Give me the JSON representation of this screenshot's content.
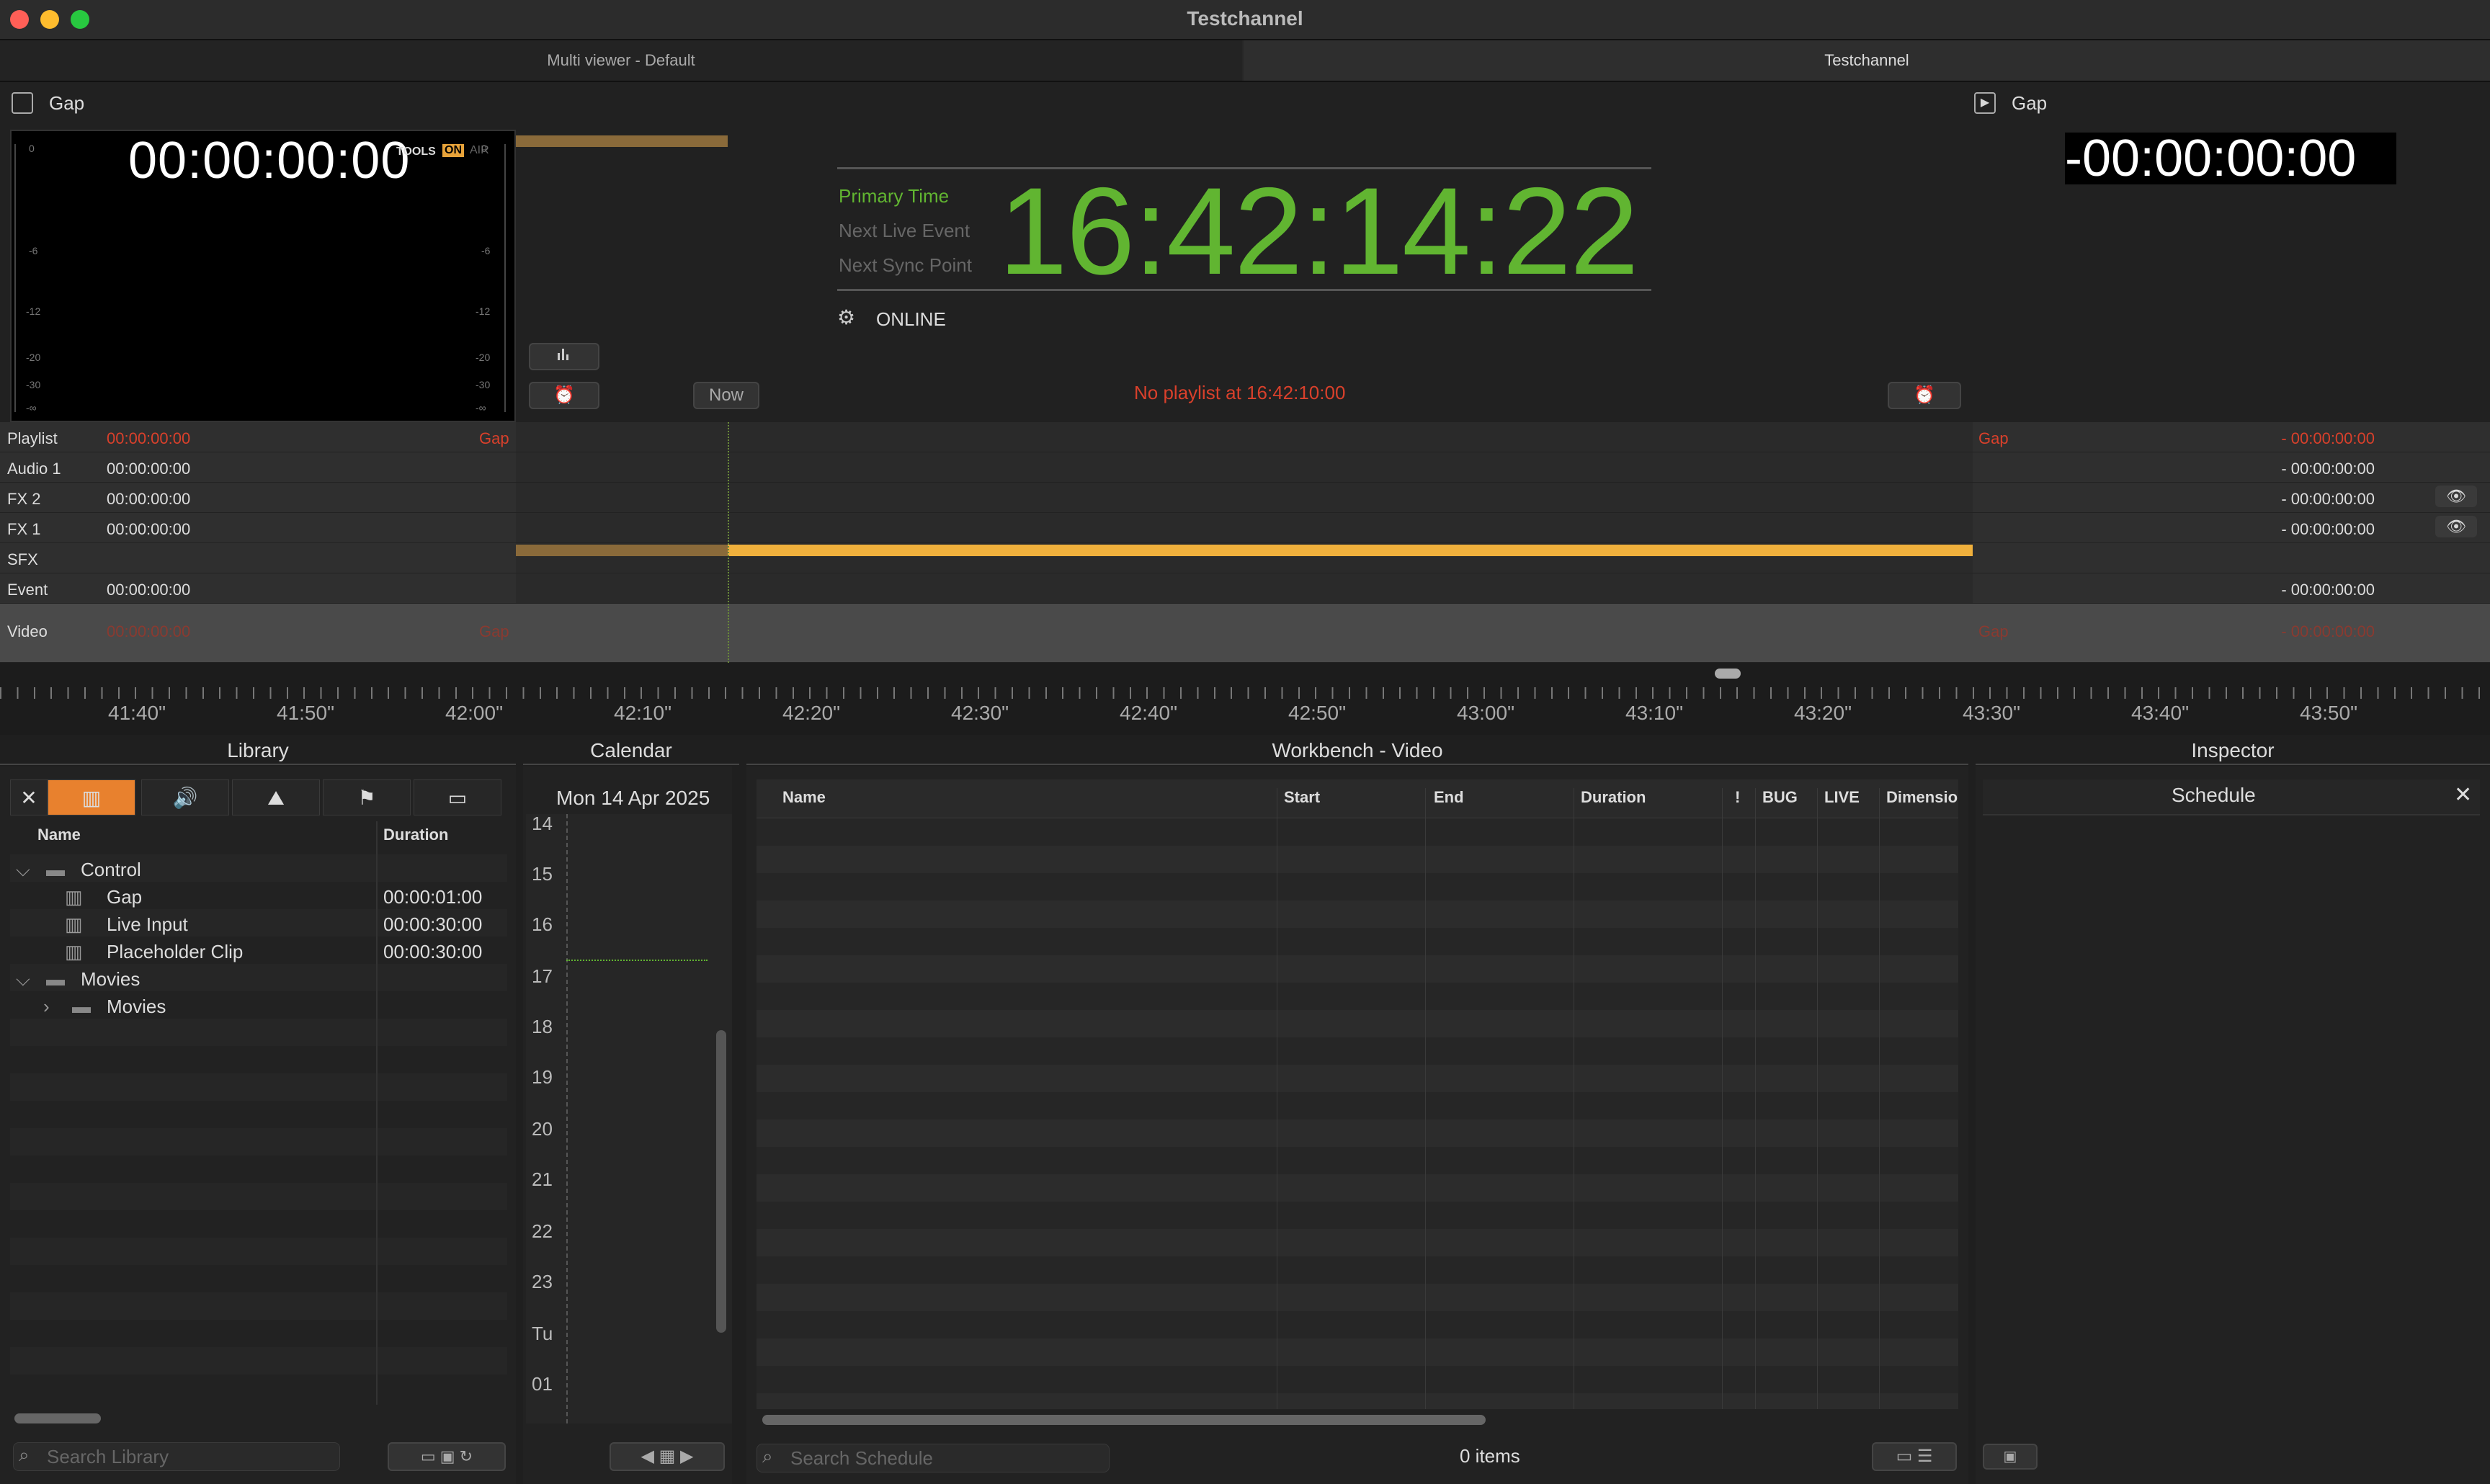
{
  "window": {
    "title": "Testchannel"
  },
  "tabs": [
    {
      "label": "Multi viewer - Default"
    },
    {
      "label": "Testchannel"
    }
  ],
  "preview_left": {
    "label": "Gap",
    "timecode": "00:00:00:00",
    "tools_label": "TOOLS",
    "on_label": "ON",
    "air_label": "AIR",
    "meter_scale": [
      "0",
      "-6",
      "-12",
      "-20",
      "-30",
      "-∞"
    ]
  },
  "preview_right": {
    "label": "Gap",
    "timecode": "-00:00:00:00"
  },
  "clock": {
    "labels": [
      "Primary Time",
      "Next Live Event",
      "Next Sync Point"
    ],
    "time": "16:42:14:22",
    "status": "ONLINE"
  },
  "controls": {
    "now_label": "Now",
    "playlist_message": "No playlist at 16:42:10:00"
  },
  "tracks": [
    {
      "name": "Playlist",
      "tc": "00:00:00:00",
      "gap": "Gap",
      "rgap": "Gap",
      "rtc": "- 00:00:00:00"
    },
    {
      "name": "Audio 1",
      "tc": "00:00:00:00",
      "gap": "",
      "rgap": "",
      "rtc": "- 00:00:00:00"
    },
    {
      "name": "FX 2",
      "tc": "00:00:00:00",
      "gap": "",
      "rgap": "",
      "rtc": "- 00:00:00:00"
    },
    {
      "name": "FX 1",
      "tc": "00:00:00:00",
      "gap": "",
      "rgap": "",
      "rtc": "- 00:00:00:00"
    },
    {
      "name": "SFX",
      "tc": "",
      "gap": "",
      "rgap": "",
      "rtc": ""
    },
    {
      "name": "Event",
      "tc": "00:00:00:00",
      "gap": "",
      "rgap": "",
      "rtc": "- 00:00:00:00"
    },
    {
      "name": "Video",
      "tc": "00:00:00:00",
      "gap": "Gap",
      "rgap": "Gap",
      "rtc": "- 00:00:00:00"
    }
  ],
  "ruler": [
    "41:40\"",
    "41:50\"",
    "42:00\"",
    "42:10\"",
    "42:20\"",
    "42:30\"",
    "42:40\"",
    "42:50\"",
    "43:00\"",
    "43:10\"",
    "43:20\"",
    "43:30\"",
    "43:40\"",
    "43:50\""
  ],
  "panels": {
    "library": "Library",
    "calendar": "Calendar",
    "workbench": "Workbench - Video",
    "inspector": "Inspector"
  },
  "library": {
    "col_name": "Name",
    "col_duration": "Duration",
    "rows": [
      {
        "name": "Control",
        "duration": ""
      },
      {
        "name": "Gap",
        "duration": "00:00:01:00"
      },
      {
        "name": "Live Input",
        "duration": "00:00:30:00"
      },
      {
        "name": "Placeholder Clip",
        "duration": "00:00:30:00"
      },
      {
        "name": "Movies",
        "duration": ""
      },
      {
        "name": "Movies",
        "duration": ""
      }
    ],
    "search_placeholder": "Search Library"
  },
  "calendar": {
    "date": "Mon 14 Apr 2025",
    "hours": [
      "14",
      "15",
      "16",
      "17",
      "18",
      "19",
      "20",
      "21",
      "22",
      "23",
      "Tu",
      "01"
    ]
  },
  "workbench": {
    "columns": [
      "Name",
      "Start",
      "End",
      "Duration",
      "!",
      "BUG",
      "LIVE",
      "Dimensio"
    ],
    "search_placeholder": "Search Schedule",
    "count": "0 items"
  },
  "inspector": {
    "title": "Schedule"
  }
}
